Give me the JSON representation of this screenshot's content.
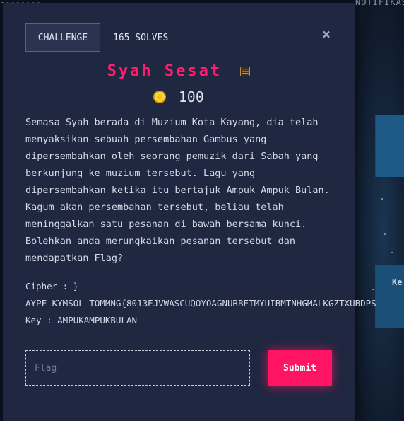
{
  "background": {
    "top_right_text": "NOTIFIKAS",
    "top_left_text": "--------",
    "card_label": "Ke"
  },
  "modal": {
    "tab_label": "CHALLENGE",
    "solves": "165 SOLVES",
    "close_symbol": "×",
    "title": "Syah Sesat",
    "points": "100",
    "description": "Semasa Syah berada di Muzium Kota Kayang, dia telah menyaksikan sebuah persembahan Gambus yang dipersembahkan oleh seorang pemuzik dari Sabah yang berkunjung ke muzium tersebut. Lagu yang dipersembahkan ketika itu bertajuk Ampuk Ampuk Bulan. Kagum akan persembahan tersebut, beliau telah meninggalkan satu pesanan di bawah bersama kunci. Bolehkan anda merungkaikan pesanan tersebut dan mendapatkan Flag?",
    "cipher_label": "Cipher : }",
    "cipher_text": "AYPF_KYMSOL_TOMMNG{8013EJVWASCUQOYOAGNURBETMYUIBMTNHGMALKGZTXUBDPS",
    "key_line": "Key : AMPUKAMPUKBULAN",
    "flag_placeholder": "Flag",
    "flag_value": "",
    "submit_label": "Submit"
  },
  "colors": {
    "modal_bg": "#1f2741",
    "accent": "#ff1463",
    "title": "#ff1f6e",
    "coin": "#f2c417"
  }
}
